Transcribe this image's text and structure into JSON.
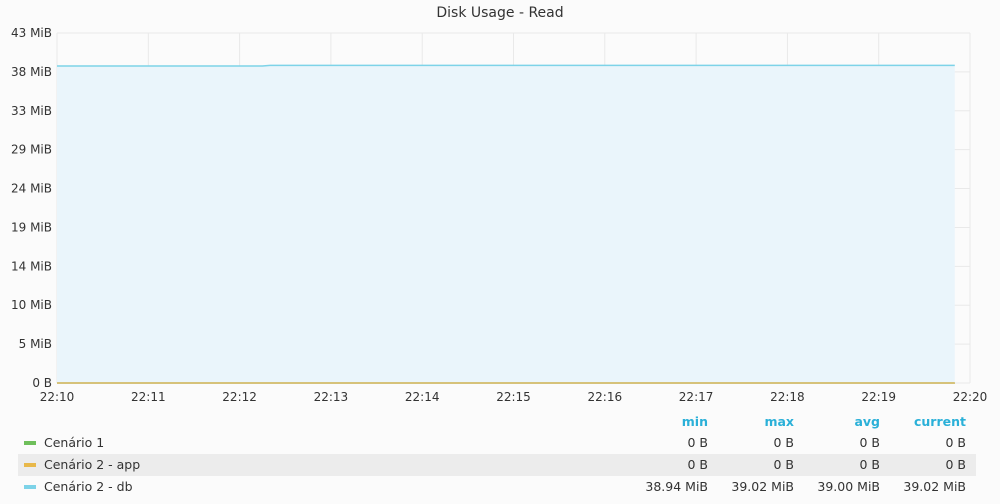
{
  "chart_data": {
    "type": "area",
    "title": "Disk Usage - Read",
    "x_ticks": [
      "22:10",
      "22:11",
      "22:12",
      "22:13",
      "22:14",
      "22:15",
      "22:16",
      "22:17",
      "22:18",
      "22:19",
      "22:20"
    ],
    "y_ticks": [
      "0 B",
      "5 MiB",
      "10 MiB",
      "14 MiB",
      "19 MiB",
      "24 MiB",
      "29 MiB",
      "33 MiB",
      "38 MiB",
      "43 MiB"
    ],
    "ylim_mib": [
      0,
      43
    ],
    "grid": true,
    "legend_columns": [
      "min",
      "max",
      "avg",
      "current"
    ],
    "series": [
      {
        "name": "Cenário 1",
        "color": "#6fbf5b",
        "x": [
          "22:10",
          "22:19:50"
        ],
        "values_mib": [
          0,
          0
        ],
        "stats": {
          "min": "0 B",
          "max": "0 B",
          "avg": "0 B",
          "current": "0 B"
        }
      },
      {
        "name": "Cenário 2 - app",
        "color": "#e8b84a",
        "x": [
          "22:10",
          "22:19:50"
        ],
        "values_mib": [
          0,
          0
        ],
        "stats": {
          "min": "0 B",
          "max": "0 B",
          "avg": "0 B",
          "current": "0 B"
        }
      },
      {
        "name": "Cenário 2 - db",
        "color": "#7dd3e8",
        "fill": "#eaf5fb",
        "x": [
          "22:10",
          "22:12:15",
          "22:12:20",
          "22:19:50"
        ],
        "values_mib": [
          38.94,
          38.94,
          39.02,
          39.02
        ],
        "stats": {
          "min": "38.94 MiB",
          "max": "39.02 MiB",
          "avg": "39.00 MiB",
          "current": "39.02 MiB"
        }
      }
    ]
  }
}
